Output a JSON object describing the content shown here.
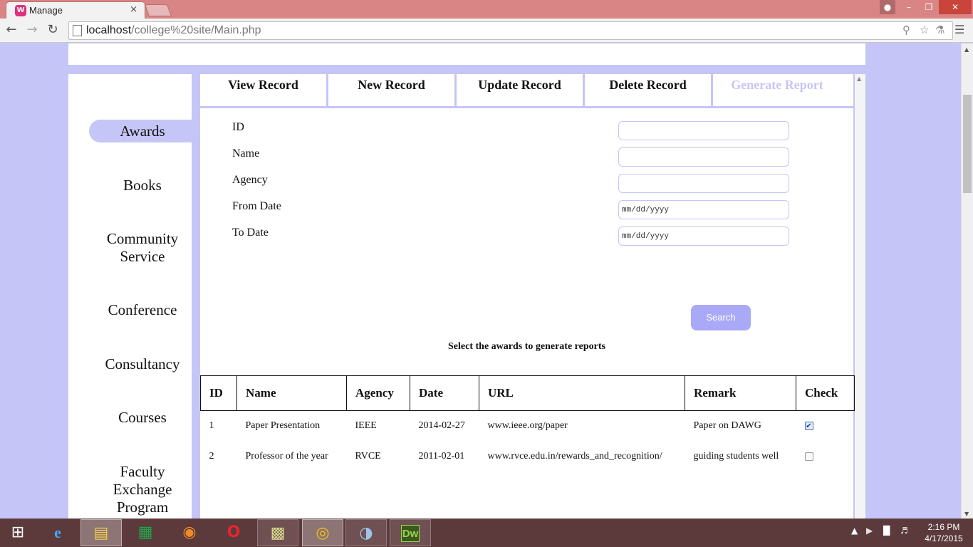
{
  "browser": {
    "tabs": [
      {
        "title": "Manage",
        "icon": "wampserver-icon",
        "close": "×"
      }
    ],
    "url": {
      "host": "localhost",
      "path": "/college%20site/Main.php"
    },
    "window_buttons": {
      "minimize": "–",
      "maximize": "❐",
      "close": "✕"
    }
  },
  "sidebar": {
    "items": [
      {
        "label": "Awards",
        "active": true
      },
      {
        "label": "Books"
      },
      {
        "label": "Community",
        "label2": "Service"
      },
      {
        "label": "Conference"
      },
      {
        "label": "Consultancy"
      },
      {
        "label": "Courses"
      },
      {
        "label": "Faculty",
        "label2": "Exchange",
        "label3": "Program"
      }
    ]
  },
  "operations": {
    "tabs": [
      {
        "label": "View Record"
      },
      {
        "label": "New Record"
      },
      {
        "label": "Update Record"
      },
      {
        "label": "Delete Record"
      },
      {
        "label": "Generate Report",
        "disabled": true
      }
    ]
  },
  "form": {
    "fields": [
      {
        "label": "ID",
        "value": ""
      },
      {
        "label": "Name",
        "value": ""
      },
      {
        "label": "Agency",
        "value": ""
      },
      {
        "label": "From Date",
        "value": "mm/dd/yyyy"
      },
      {
        "label": "To Date",
        "value": "mm/dd/yyyy"
      }
    ],
    "search_label": "Search",
    "instructions": "Select the awards to generate reports"
  },
  "table": {
    "columns": [
      "ID",
      "Name",
      "Agency",
      "Date",
      "URL",
      "Remark",
      "Check"
    ],
    "rows": [
      {
        "id": "1",
        "name": "Paper Presentation",
        "agency": "IEEE",
        "date": "2014-02-27",
        "url": "www.ieee.org/paper",
        "remark": "Paper on DAWG",
        "checked": true,
        "check_mark": "✔"
      },
      {
        "id": "2",
        "name": "Professor of the year",
        "agency": "RVCE",
        "date": "2011-02-01",
        "url": "www.rvce.edu.in/rewards_and_recognition/",
        "remark": "guiding students well",
        "checked": false,
        "check_mark": ""
      }
    ]
  },
  "taskbar": {
    "apps": [
      "start-icon",
      "internet-explorer-icon",
      "file-explorer-icon",
      "store-icon",
      "firefox-icon",
      "opera-icon",
      "sticky-notes-icon",
      "chrome-icon",
      "paint-icon",
      "dreamweaver-icon"
    ],
    "dreamweaver_label": "Dw",
    "clock": {
      "time": "2:16 PM",
      "date": "4/17/2015"
    }
  },
  "colors": {
    "accent": "#c5c5f7",
    "button": "#a9a9f8",
    "titlebar": "#d98585",
    "taskbar": "#5c3a3c"
  }
}
